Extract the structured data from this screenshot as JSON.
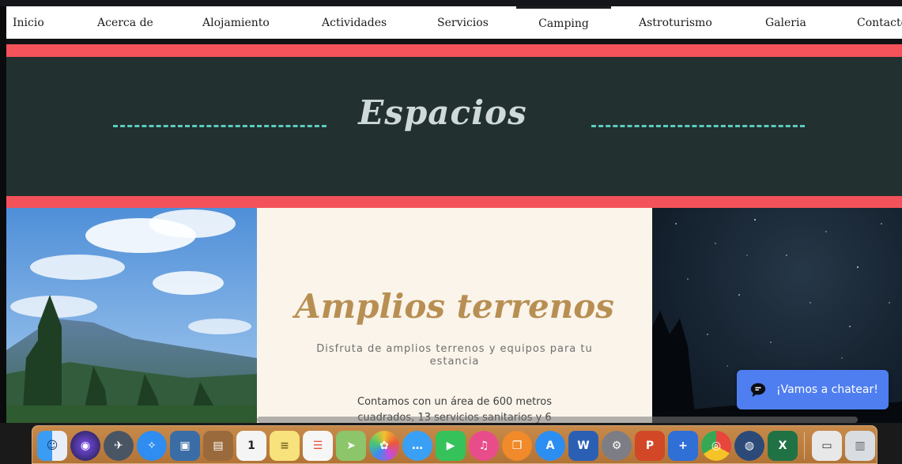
{
  "nav": {
    "items": [
      {
        "label": "Inicio"
      },
      {
        "label": "Acerca de"
      },
      {
        "label": "Alojamiento"
      },
      {
        "label": "Actividades"
      },
      {
        "label": "Servicios"
      },
      {
        "label": "Camping",
        "active": true
      },
      {
        "label": "Astroturismo"
      },
      {
        "label": "Galeria"
      },
      {
        "label": "Contacto"
      }
    ]
  },
  "banner": {
    "title": "Espacios"
  },
  "feature": {
    "title": "Amplios terrenos",
    "subtitle": "Disfruta de amplios terrenos y equipos para tu estancia",
    "body": "Contamos con un área de 600 metros cuadrados, 13 servicios sanitarios y 6"
  },
  "chat": {
    "label": "¡Vamos a chatear!"
  },
  "colors": {
    "accent_red": "#f3525a",
    "banner_bg": "#22302f",
    "dash": "#5ccbc0",
    "panel_bg": "#faf4ea",
    "title_gold": "#b88f53",
    "chat_blue": "#4f7ef0"
  },
  "dock": {
    "icons": [
      {
        "name": "finder-icon",
        "glyph": "☺"
      },
      {
        "name": "siri-icon",
        "glyph": "◉"
      },
      {
        "name": "launchpad-icon",
        "glyph": "✈"
      },
      {
        "name": "safari-icon",
        "glyph": "✧"
      },
      {
        "name": "preview-icon",
        "glyph": "▣"
      },
      {
        "name": "contacts-icon",
        "glyph": "▤"
      },
      {
        "name": "calendar-icon",
        "glyph": "1"
      },
      {
        "name": "notes-icon",
        "glyph": "≡"
      },
      {
        "name": "reminders-icon",
        "glyph": "☰"
      },
      {
        "name": "maps-icon",
        "glyph": "➤"
      },
      {
        "name": "photos-icon",
        "glyph": "✿"
      },
      {
        "name": "messages-icon",
        "glyph": "…"
      },
      {
        "name": "facetime-icon",
        "glyph": "▶"
      },
      {
        "name": "itunes-icon",
        "glyph": "♫"
      },
      {
        "name": "books-icon",
        "glyph": "❐"
      },
      {
        "name": "app-store-icon",
        "glyph": "A"
      },
      {
        "name": "word-icon",
        "glyph": "W"
      },
      {
        "name": "system-preferences-icon",
        "glyph": "⚙"
      },
      {
        "name": "powerpoint-icon",
        "glyph": "P"
      },
      {
        "name": "keynote-icon",
        "glyph": "+"
      },
      {
        "name": "chrome-icon",
        "glyph": "◎"
      },
      {
        "name": "globe-icon",
        "glyph": "◍"
      },
      {
        "name": "excel-icon",
        "glyph": "X"
      },
      {
        "name": "screen-icon",
        "glyph": "▭"
      },
      {
        "name": "trash-icon",
        "glyph": "▥"
      }
    ]
  }
}
